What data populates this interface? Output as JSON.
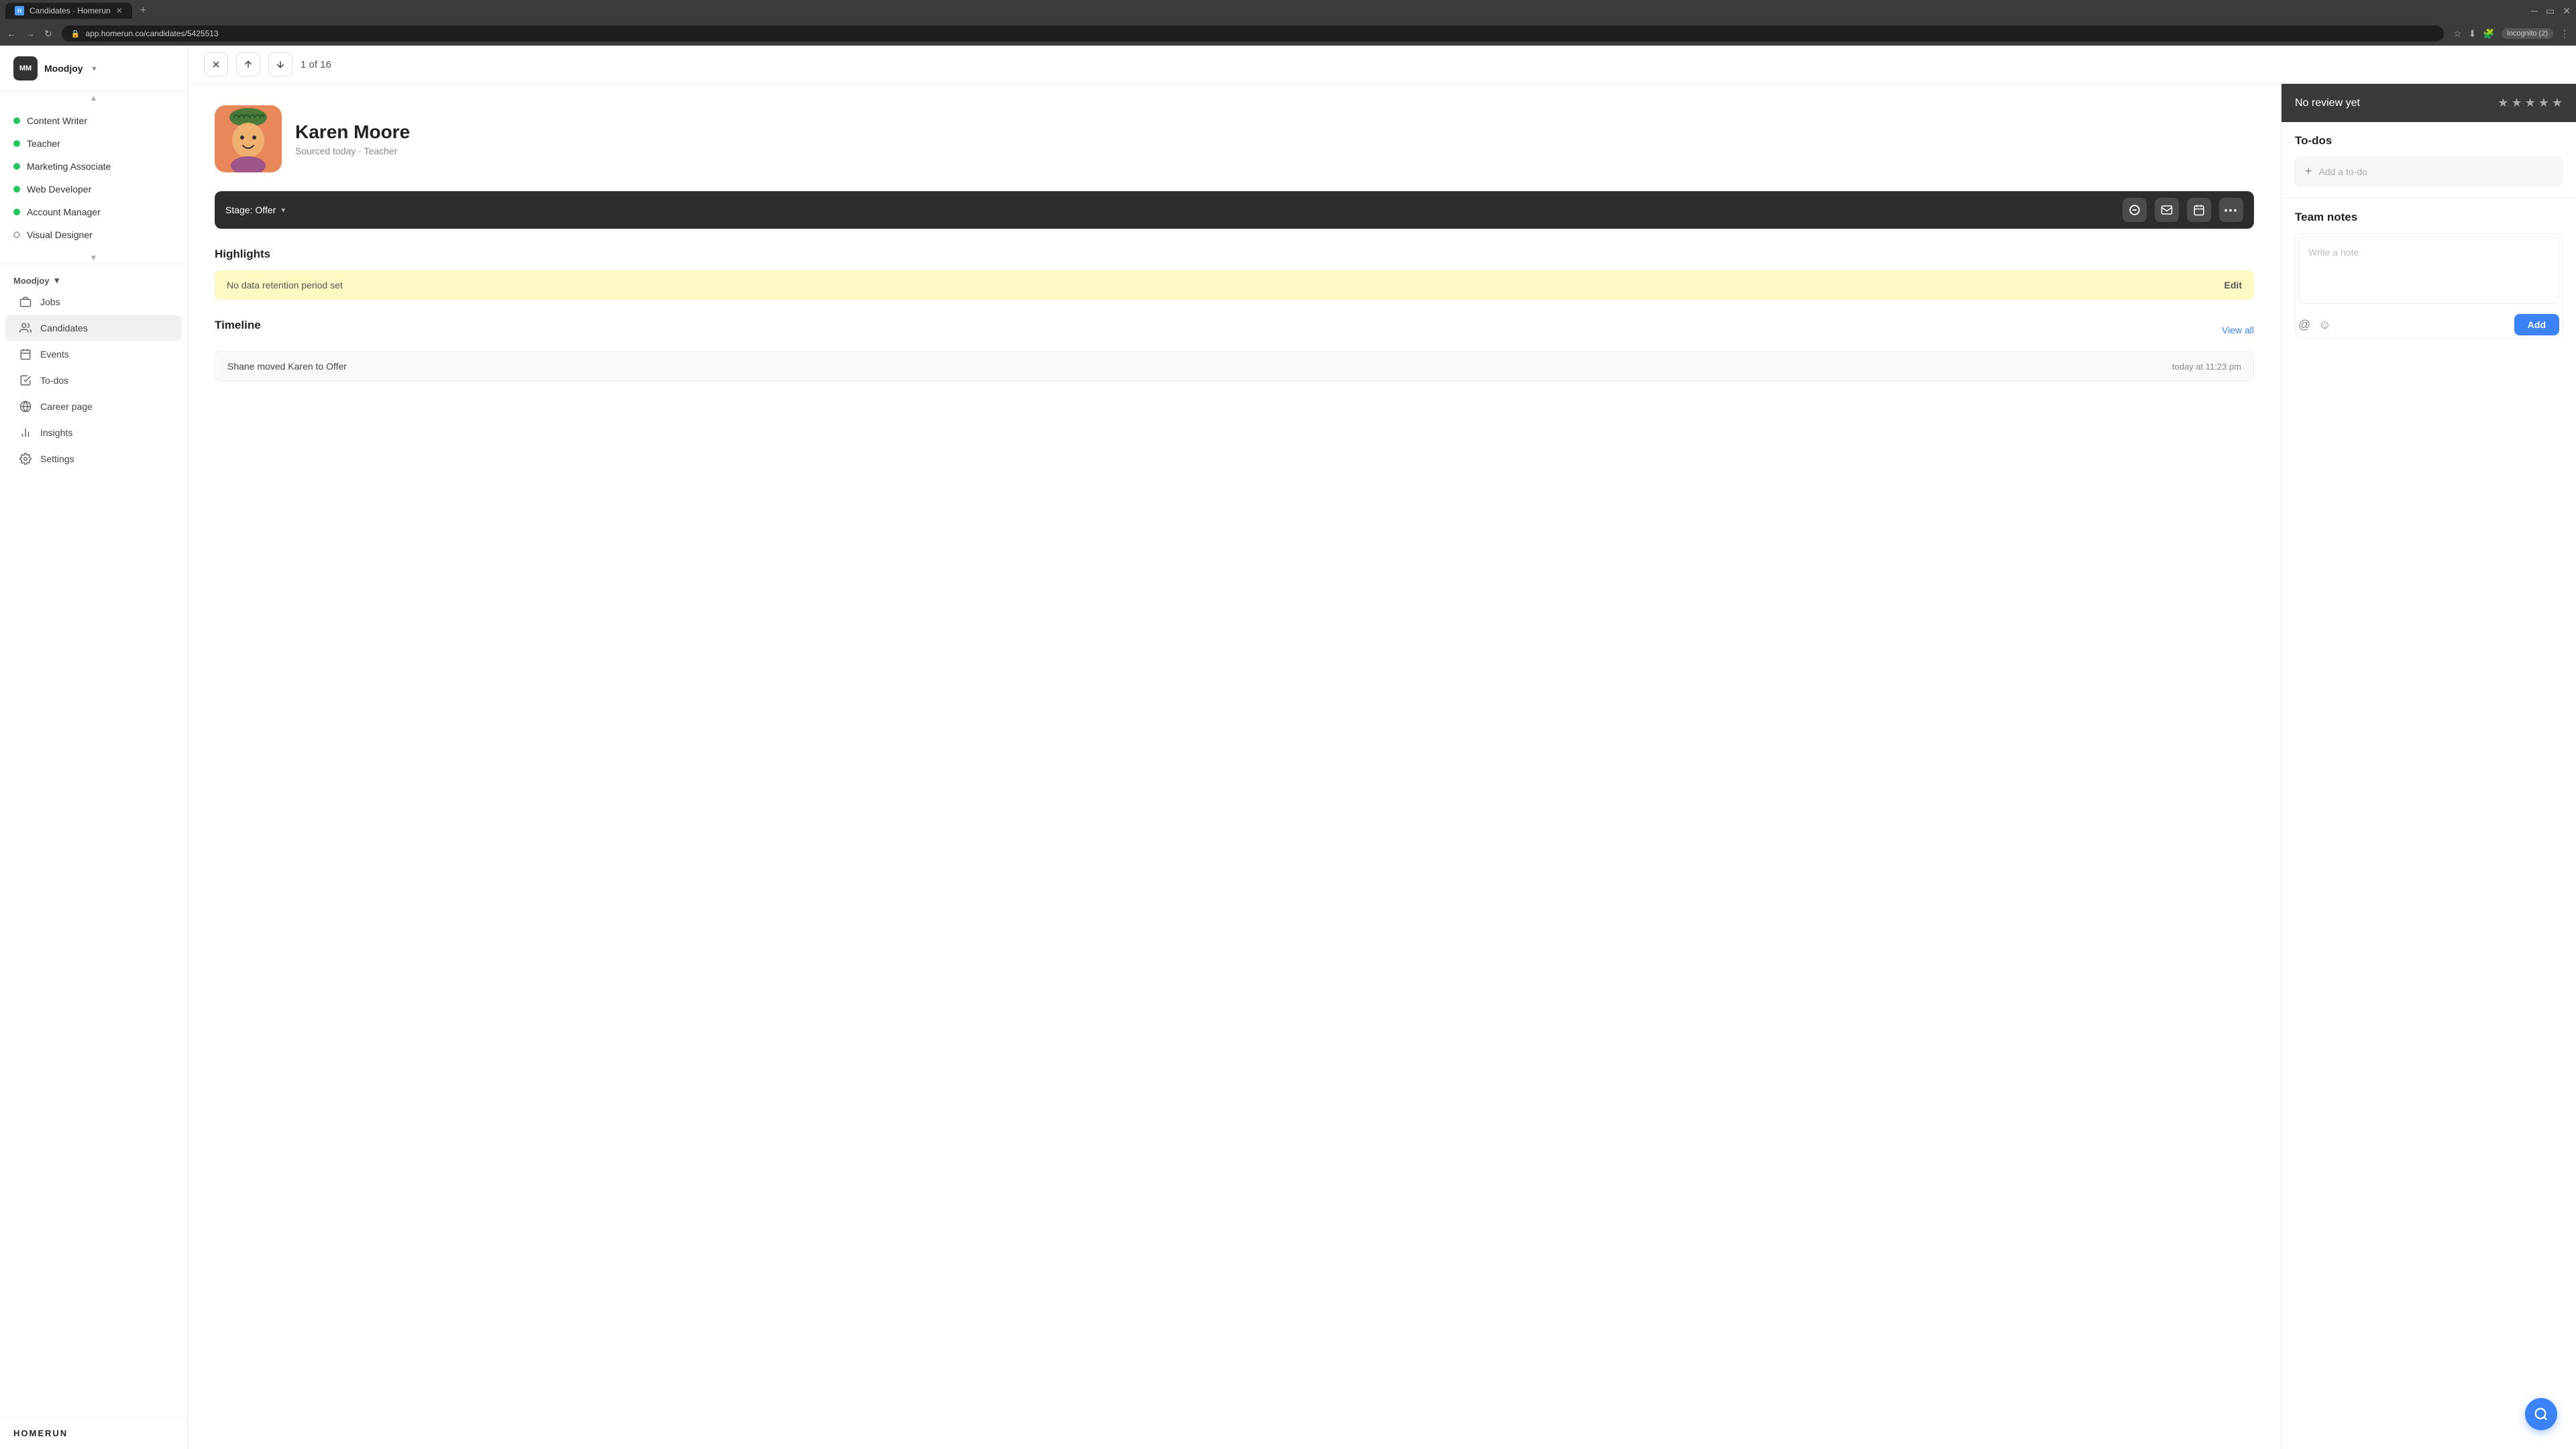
{
  "browser": {
    "tab_title": "Candidates · Homerun",
    "tab_favicon": "H",
    "url": "app.homerun.co/candidates/5425513",
    "incognito_label": "Incognito (2)"
  },
  "sidebar": {
    "company_initials": "MM",
    "company_name": "Moodjoy",
    "dropdown_icon": "▾",
    "jobs": [
      {
        "label": "Content Writer",
        "dot_active": true
      },
      {
        "label": "Teacher",
        "dot_active": true
      },
      {
        "label": "Marketing Associate",
        "dot_active": true
      },
      {
        "label": "Web Developer",
        "dot_active": true
      },
      {
        "label": "Account Manager",
        "dot_active": true
      },
      {
        "label": "Visual Designer",
        "dot_active": false
      }
    ],
    "section_company": "Moodjoy",
    "nav_items": [
      {
        "label": "Jobs",
        "icon": "briefcase"
      },
      {
        "label": "Candidates",
        "icon": "people",
        "active": true
      },
      {
        "label": "Events",
        "icon": "calendar"
      },
      {
        "label": "To-dos",
        "icon": "checkbox"
      },
      {
        "label": "Career page",
        "icon": "globe"
      },
      {
        "label": "Insights",
        "icon": "chart"
      },
      {
        "label": "Settings",
        "icon": "settings"
      }
    ],
    "logo": "HOMERUN"
  },
  "toolbar": {
    "counter": "1 of 16"
  },
  "candidate": {
    "name": "Karen Moore",
    "meta": "Sourced today · Teacher",
    "stage_label": "Stage: Offer",
    "review_label": "No review yet",
    "stars": [
      false,
      false,
      false,
      false,
      false
    ]
  },
  "highlights": {
    "title": "Highlights",
    "warning_text": "No data retention period set",
    "edit_label": "Edit"
  },
  "timeline": {
    "title": "Timeline",
    "view_all_label": "View all",
    "entry_text": "Shane moved Karen to Offer",
    "entry_time": "today at 11:23 pm"
  },
  "todos": {
    "title": "To-dos",
    "add_placeholder": "Add a to-do"
  },
  "team_notes": {
    "title": "Team notes",
    "textarea_placeholder": "Write a note",
    "add_button_label": "Add"
  }
}
